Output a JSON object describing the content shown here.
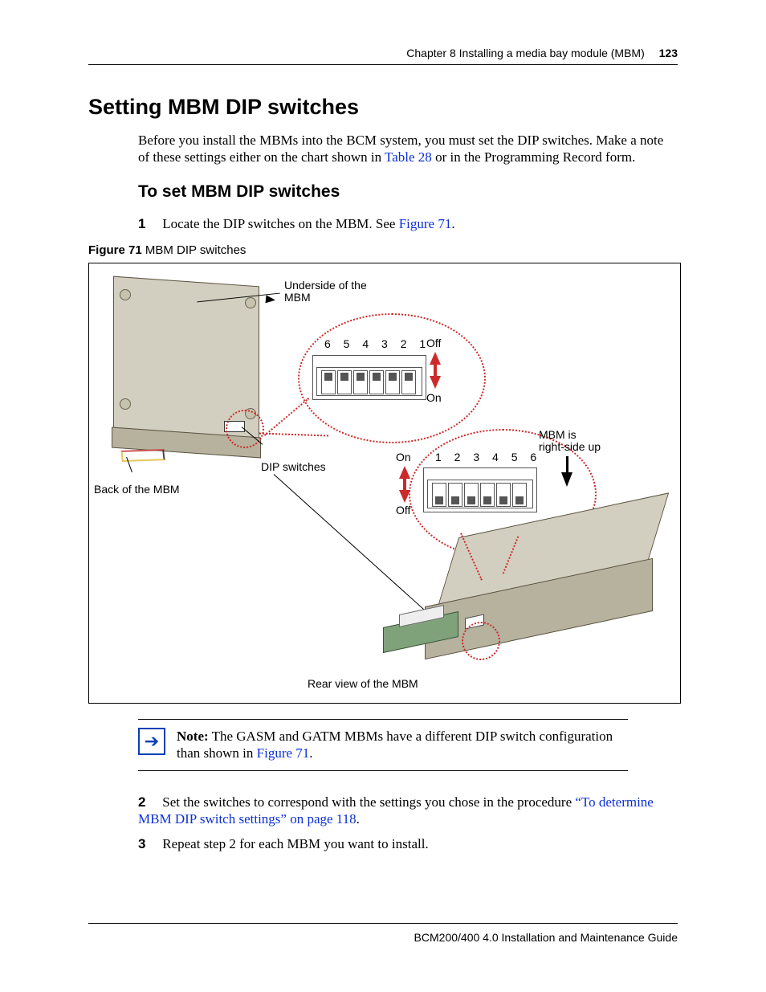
{
  "header": {
    "chapter": "Chapter 8  Installing a media bay module (MBM)",
    "page_number": "123"
  },
  "h1": "Setting MBM DIP switches",
  "intro": {
    "text_a": "Before you install the MBMs into the BCM system, you must set the DIP switches. Make a note of these settings either on the chart shown in ",
    "link": "Table 28",
    "text_b": " or in the Programming Record form."
  },
  "h2": "To set MBM DIP switches",
  "steps": {
    "s1": {
      "num": "1",
      "text_a": "Locate the DIP switches on the MBM. See ",
      "link": "Figure 71",
      "text_b": "."
    },
    "s2": {
      "num": "2",
      "text_a": "Set the switches to correspond with the settings you chose in the procedure ",
      "link": "“To determine MBM DIP switch settings” on page 118",
      "text_b": "."
    },
    "s3": {
      "num": "3",
      "text": "Repeat step 2 for each MBM you want to install."
    }
  },
  "figure": {
    "label_bold": "Figure 71",
    "label_rest": "   MBM DIP switches",
    "labels": {
      "underside": "Underside of the\nMBM",
      "dip_switches": "DIP switches",
      "back": "Back of the MBM",
      "rear_view": "Rear view of the MBM",
      "mbm_up": "MBM is\nright-side up",
      "off1": "Off",
      "on1": "On",
      "on2": "On",
      "off2": "Off",
      "nums_desc": "6  5  4  3  2  1",
      "nums_asc": "1  2  3  4  5  6"
    }
  },
  "note": {
    "bold": "Note:",
    "text_a": " The GASM and GATM MBMs have a different DIP switch configuration than shown in ",
    "link": "Figure 71",
    "text_b": "."
  },
  "footer": "BCM200/400 4.0 Installation and Maintenance Guide"
}
